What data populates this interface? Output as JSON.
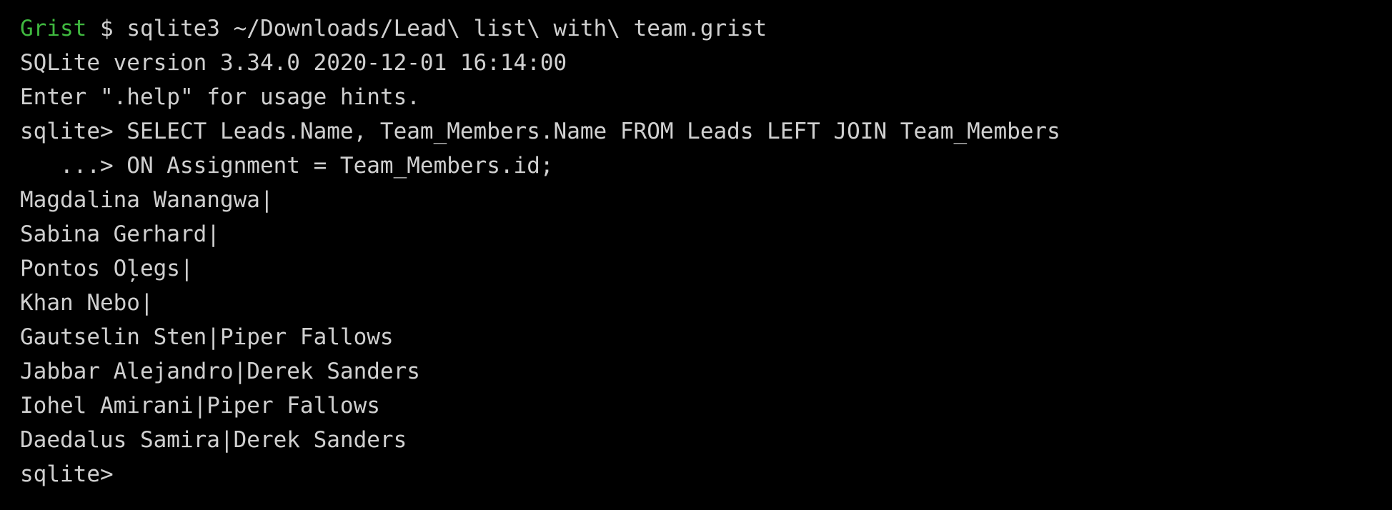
{
  "terminal": {
    "app": "sqlite3-terminal",
    "background_color": "#000000",
    "foreground_color": "#d0d0d0",
    "accent_color": "#3fb83f",
    "lines": [
      {
        "id": "command-line",
        "segments": [
          {
            "name": "shell-prompt-host",
            "text": "Grist",
            "style": "prompt-host"
          },
          {
            "name": "shell-prompt-symbol-and-command",
            "text": " $ sqlite3 ~/Downloads/Lead\\ list\\ with\\ team.grist",
            "style": "plain"
          }
        ]
      },
      {
        "id": "sqlite-version-line",
        "segments": [
          {
            "name": "sqlite-version-text",
            "text": "SQLite version 3.34.0 2020-12-01 16:14:00",
            "style": "plain"
          }
        ]
      },
      {
        "id": "help-hint-line",
        "segments": [
          {
            "name": "sqlite-help-hint-text",
            "text": "Enter \".help\" for usage hints.",
            "style": "plain"
          }
        ]
      },
      {
        "id": "query-line-1",
        "segments": [
          {
            "name": "sqlite-prompt-and-query",
            "text": "sqlite> SELECT Leads.Name, Team_Members.Name FROM Leads LEFT JOIN Team_Members",
            "style": "plain"
          }
        ]
      },
      {
        "id": "query-line-2",
        "segments": [
          {
            "name": "sqlite-continuation-prompt-and-query",
            "text": "   ...> ON Assignment = Team_Members.id;",
            "style": "plain"
          }
        ]
      },
      {
        "id": "result-row-1",
        "segments": [
          {
            "name": "query-result-row",
            "text": "Magdalina Wanangwa|",
            "style": "plain"
          }
        ]
      },
      {
        "id": "result-row-2",
        "segments": [
          {
            "name": "query-result-row",
            "text": "Sabina Gerhard|",
            "style": "plain"
          }
        ]
      },
      {
        "id": "result-row-3",
        "segments": [
          {
            "name": "query-result-row",
            "text": "Pontos Oļegs|",
            "style": "plain"
          }
        ]
      },
      {
        "id": "result-row-4",
        "segments": [
          {
            "name": "query-result-row",
            "text": "Khan Nebo|",
            "style": "plain"
          }
        ]
      },
      {
        "id": "result-row-5",
        "segments": [
          {
            "name": "query-result-row",
            "text": "Gautselin Sten|Piper Fallows",
            "style": "plain"
          }
        ]
      },
      {
        "id": "result-row-6",
        "segments": [
          {
            "name": "query-result-row",
            "text": "Jabbar Alejandro|Derek Sanders",
            "style": "plain"
          }
        ]
      },
      {
        "id": "result-row-7",
        "segments": [
          {
            "name": "query-result-row",
            "text": "Iohel Amirani|Piper Fallows",
            "style": "plain"
          }
        ]
      },
      {
        "id": "result-row-8",
        "segments": [
          {
            "name": "query-result-row",
            "text": "Daedalus Samira|Derek Sanders",
            "style": "plain"
          }
        ]
      },
      {
        "id": "final-prompt-line",
        "segments": [
          {
            "name": "sqlite-prompt",
            "text": "sqlite>",
            "style": "plain"
          }
        ]
      }
    ]
  }
}
